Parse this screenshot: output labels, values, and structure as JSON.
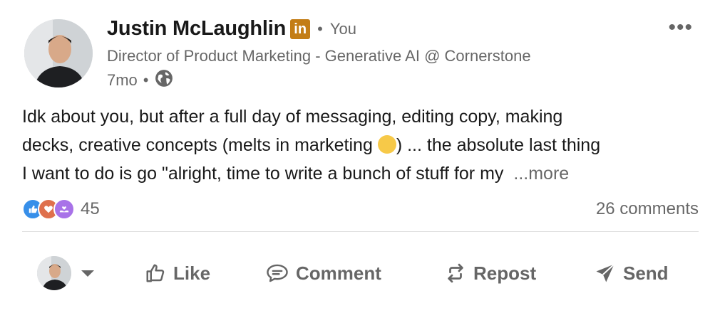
{
  "author": {
    "name": "Justin McLaughlin",
    "badge": "in",
    "relation_dot": "•",
    "relation": "You",
    "headline": "Director of Product Marketing - Generative AI @ Cornerstone",
    "time": "7mo",
    "time_dot": "•",
    "visibility_icon": "globe-icon"
  },
  "menu": {
    "label": "•••"
  },
  "post": {
    "line1": "Idk about you, but after a full day of messaging, editing copy, making",
    "line2_before": "decks, creative concepts (melts in marketing ",
    "line2_after": ") ... the absolute last thing",
    "line3": "I want to do is go \"alright, time to write a bunch of stuff for my",
    "see_more": "...more"
  },
  "social": {
    "reaction_count": "45",
    "comments": "26 comments",
    "reaction_icons": [
      "like-icon",
      "love-icon",
      "support-icon"
    ]
  },
  "actions": {
    "like": "Like",
    "comment": "Comment",
    "repost": "Repost",
    "send": "Send"
  },
  "colors": {
    "linkedin_badge": "#c37d16",
    "like_blue": "#378fe9",
    "love_red": "#df704d",
    "support_purple": "#a872e8",
    "text_secondary": "#666666"
  }
}
